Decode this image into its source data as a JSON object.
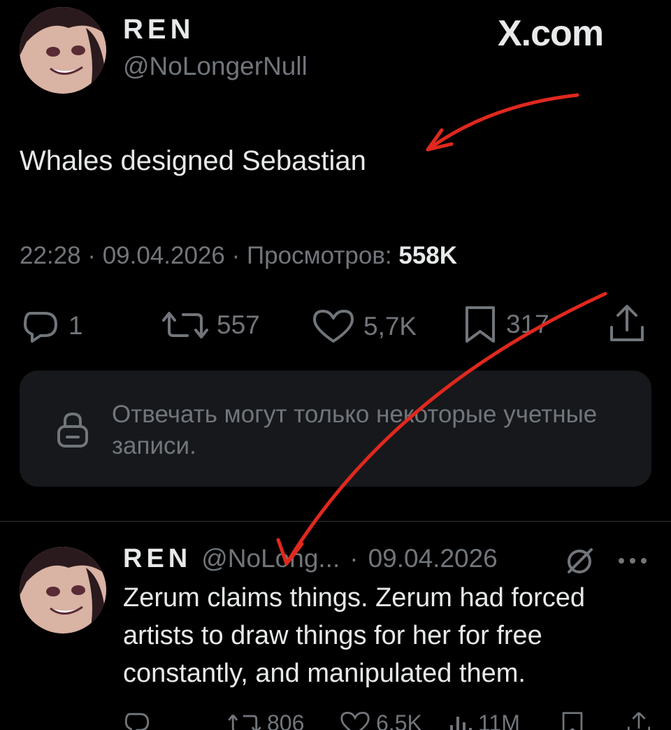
{
  "header": {
    "display_name": "REN",
    "handle": "@NoLongerNull",
    "brand": "X.com"
  },
  "tweet": {
    "text": "Whales designed Sebastian",
    "time": "22:28",
    "date": "09.04.2026",
    "views_label": "Просмотров:",
    "views": "558K",
    "separator": "·"
  },
  "actions": {
    "replies": "1",
    "reposts": "557",
    "likes": "5,7K",
    "bookmarks": "317"
  },
  "reply_restriction": {
    "text": "Отвечать могут только некоторые учетные записи."
  },
  "reply": {
    "display_name": "REN",
    "handle": "@NoLong...",
    "separator": "·",
    "date": "09.04.2026",
    "text": "Zerum claims things. Zerum had forced artists to draw things for her for free constantly, and manipulated them.",
    "reposts": "806",
    "likes": "6,5K",
    "views": "11M"
  },
  "colors": {
    "background": "#000000",
    "text_primary": "#e7e9ea",
    "text_secondary": "#71767b",
    "panel": "#16181c",
    "annotation_arrow": "#e0281e"
  }
}
